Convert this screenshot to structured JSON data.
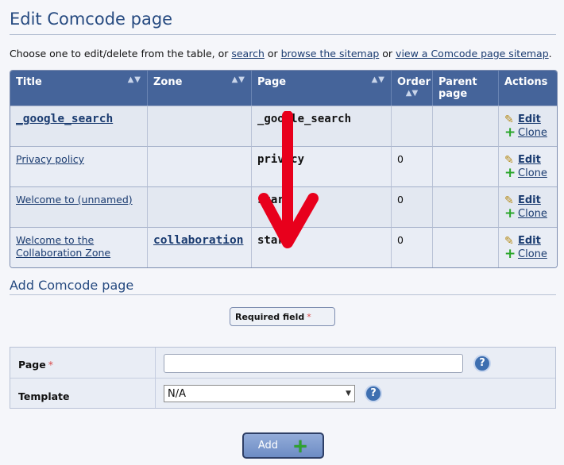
{
  "page": {
    "title": "Edit Comcode page"
  },
  "intro": {
    "prefix": "Choose one to edit/delete from the table, or ",
    "link_search": "search",
    "or1": " or ",
    "link_browse": "browse the sitemap",
    "or2": " or ",
    "link_view": "view a Comcode page sitemap",
    "suffix": "."
  },
  "table": {
    "headers": {
      "title": "Title",
      "zone": "Zone",
      "page": "Page",
      "order": "Order",
      "parent": "Parent page",
      "actions": "Actions"
    },
    "rows": [
      {
        "title": "_google_search",
        "zone": "",
        "page": "_google_search",
        "order": "",
        "parent": "",
        "edit": "Edit",
        "clone": "Clone"
      },
      {
        "title": "Privacy policy",
        "zone": "",
        "page": "privacy",
        "order": "0",
        "parent": "",
        "edit": "Edit",
        "clone": "Clone"
      },
      {
        "title": "Welcome to (unnamed)",
        "zone": "",
        "page": "start",
        "order": "0",
        "parent": "",
        "edit": "Edit",
        "clone": "Clone"
      },
      {
        "title": "Welcome to the Collaboration Zone",
        "zone": "collaboration",
        "page": "start",
        "order": "0",
        "parent": "",
        "edit": "Edit",
        "clone": "Clone"
      }
    ]
  },
  "add_section": {
    "title": "Add Comcode page",
    "required_note": "Required field",
    "required_star": "*",
    "fields": {
      "page_label": "Page",
      "page_value": "",
      "template_label": "Template",
      "template_selected": "N/A"
    },
    "submit_label": "Add"
  },
  "colors": {
    "header_bg": "#45649a",
    "accent_blue": "#264a80",
    "arrow_red": "#e8001c",
    "plus_green": "#2ea32e"
  },
  "icons": {
    "sort": "sort-arrows-icon",
    "edit": "pencil-icon",
    "clone": "plus-icon",
    "help": "help-icon",
    "arrow": "down-arrow-icon"
  }
}
